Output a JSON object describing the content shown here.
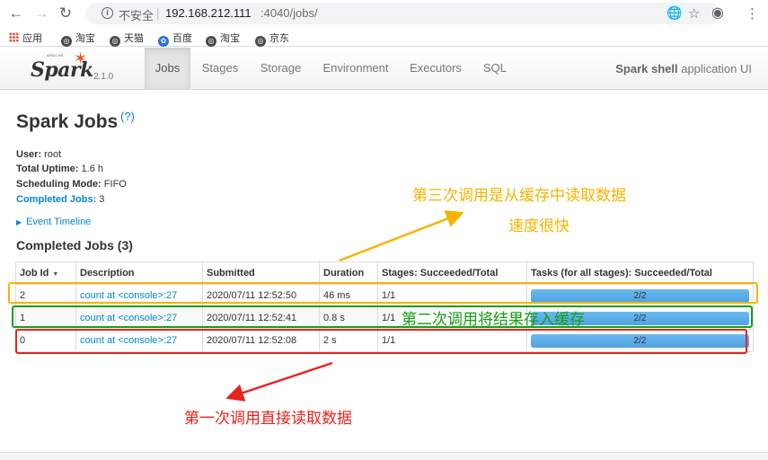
{
  "browser": {
    "security_text": "不安全",
    "separator": "|",
    "url_host": "192.168.212.111",
    "url_path": ":4040/jobs/",
    "back_icon": "arrow-back-icon",
    "forward_icon": "arrow-forward-icon",
    "reload_icon": "reload-icon",
    "translate_icon": "translate-icon",
    "star_icon": "star-icon",
    "account_icon": "account-icon",
    "menu_icon": "more-vert-icon"
  },
  "bookmarks": [
    {
      "label": "应用"
    },
    {
      "label": "淘宝"
    },
    {
      "label": "天猫"
    },
    {
      "label": "百度"
    },
    {
      "label": "淘宝"
    },
    {
      "label": "京东"
    }
  ],
  "spark_nav": {
    "logo_text": "Spark",
    "logo_apache": "APACHE",
    "version": "2.1.0",
    "tabs": [
      {
        "label": "Jobs",
        "active": true
      },
      {
        "label": "Stages",
        "active": false
      },
      {
        "label": "Storage",
        "active": false
      },
      {
        "label": "Environment",
        "active": false
      },
      {
        "label": "Executors",
        "active": false
      },
      {
        "label": "SQL",
        "active": false
      }
    ],
    "app_name_bold": "Spark shell",
    "app_name_rest": " application UI"
  },
  "page": {
    "title": "Spark Jobs",
    "help": "(?)",
    "user_label": "User:",
    "user_value": " root",
    "uptime_label": "Total Uptime:",
    "uptime_value": " 1.6 h",
    "scheduling_label": "Scheduling Mode:",
    "scheduling_value": " FIFO",
    "completed_label": "Completed Jobs:",
    "completed_value": " 3",
    "event_timeline": "Event Timeline",
    "section_title": "Completed Jobs (3)"
  },
  "table": {
    "headers": [
      "Job Id",
      "Description",
      "Submitted",
      "Duration",
      "Stages: Succeeded/Total",
      "Tasks (for all stages): Succeeded/Total"
    ],
    "rows": [
      {
        "id": "2",
        "description": "count at <console>:27",
        "submitted": "2020/07/11 12:52:50",
        "duration": "46 ms",
        "stages": "1/1",
        "tasks": "2/2",
        "progress": 1.0
      },
      {
        "id": "1",
        "description": "count at <console>:27",
        "submitted": "2020/07/11 12:52:41",
        "duration": "0.8 s",
        "stages": "1/1",
        "tasks": "2/2",
        "progress": 1.0
      },
      {
        "id": "0",
        "description": "count at <console>:27",
        "submitted": "2020/07/11 12:52:08",
        "duration": "2 s",
        "stages": "1/1",
        "tasks": "2/2",
        "progress": 1.0
      }
    ]
  },
  "annotations": {
    "third_line1": "第三次调用是从缓存中读取数据",
    "third_line2": "速度很快",
    "second": "第二次调用将结果存入缓存",
    "first": "第一次调用直接读取数据",
    "colors": {
      "orange": "#f5b400",
      "green": "#16a016",
      "red": "#e8231f",
      "blue_link": "#0088cc"
    }
  }
}
